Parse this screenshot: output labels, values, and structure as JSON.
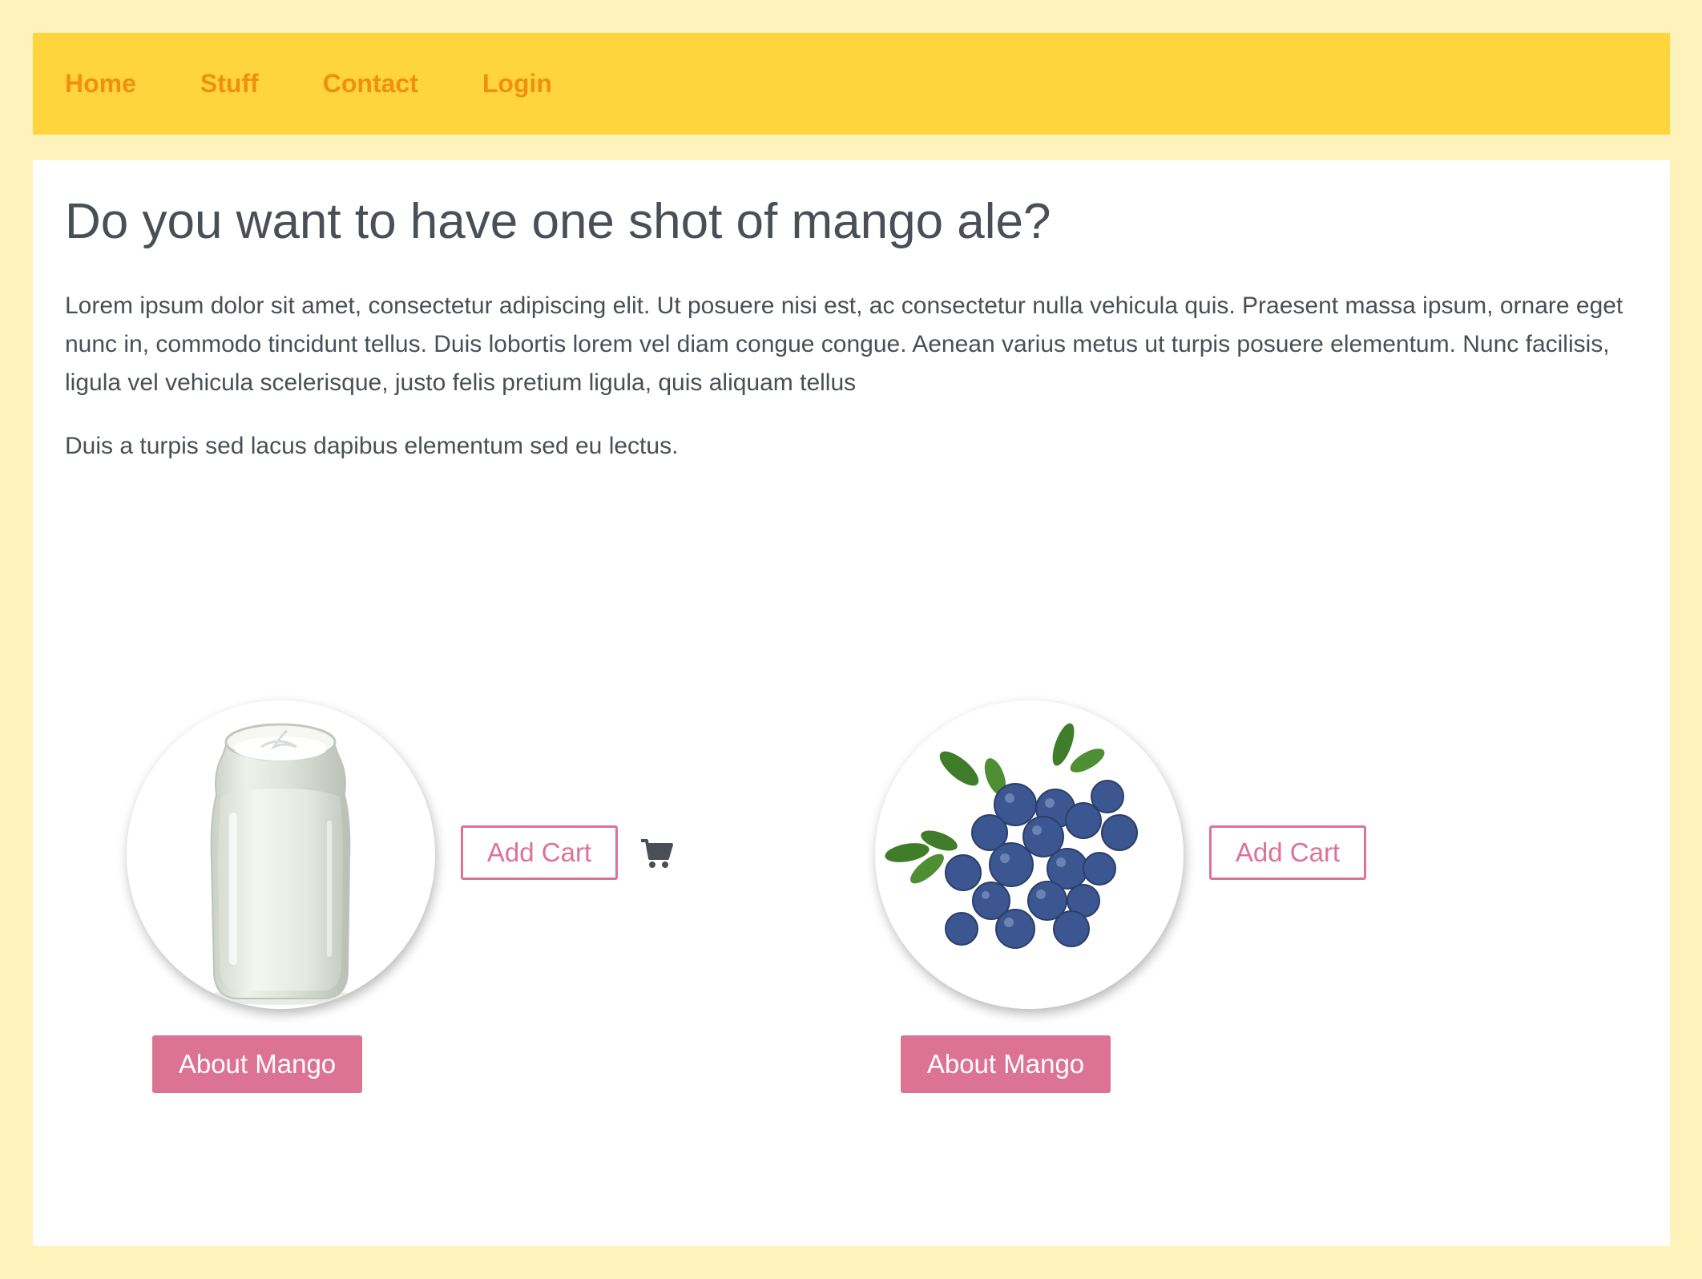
{
  "nav": {
    "items": [
      {
        "label": "Home"
      },
      {
        "label": "Stuff"
      },
      {
        "label": "Contact"
      },
      {
        "label": "Login"
      }
    ]
  },
  "main": {
    "title": "Do you want to have one shot of mango ale?",
    "paragraph1": "Lorem ipsum dolor sit amet, consectetur adipiscing elit. Ut posuere nisi est, ac consectetur nulla vehicula quis. Praesent massa ipsum, ornare eget nunc in, commodo tincidunt tellus. Duis lobortis lorem vel diam congue congue. Aenean varius metus ut turpis posuere elementum. Nunc facilisis, ligula vel vehicula scelerisque, justo felis pretium ligula, quis aliquam tellus",
    "paragraph2": "Duis a turpis sed lacus dapibus elementum sed eu lectus."
  },
  "products": [
    {
      "image": "milk-bottle",
      "add_cart_label": "Add Cart",
      "about_label": "About Mango",
      "cart_icon": "shopping-cart-icon"
    },
    {
      "image": "blueberries",
      "add_cart_label": "Add Cart",
      "about_label": "About Mango"
    }
  ],
  "colors": {
    "page_background": "#fff2bb",
    "navbar_background": "#ffd53d",
    "nav_link": "#f0900e",
    "accent": "#dd7394",
    "text": "#4a4f57"
  }
}
